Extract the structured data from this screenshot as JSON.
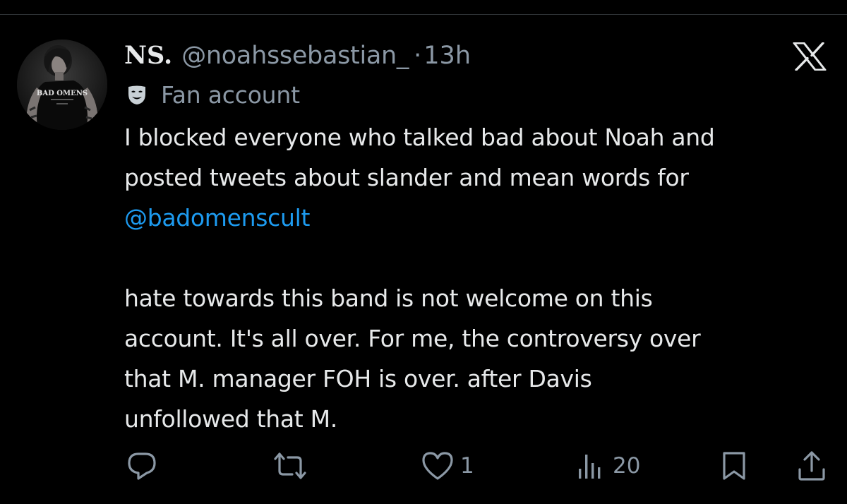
{
  "tweet": {
    "author": {
      "display_name": "NS.",
      "handle": "@noahssebastian_",
      "separator": "·",
      "time": "13h",
      "avatar_shirt_text": "BAD OMENS"
    },
    "label": {
      "icon": "theater-mask-icon",
      "text": "Fan account"
    },
    "text": {
      "line1": "I blocked everyone who talked bad about Noah and",
      "line2": "posted tweets about slander and mean words for",
      "mention": "@badomenscult",
      "line4": "hate towards this band is not welcome on this",
      "line5": "account. It's all over. For me, the controversy over",
      "line6": "that M. manager FOH is over. after Davis",
      "line7": "unfollowed that M."
    },
    "actions": {
      "reply": {
        "icon": "reply-icon"
      },
      "repost": {
        "icon": "repost-icon"
      },
      "like": {
        "icon": "heart-icon",
        "count": "1"
      },
      "views": {
        "icon": "views-icon",
        "count": "20"
      },
      "bookmark": {
        "icon": "bookmark-icon"
      },
      "share": {
        "icon": "share-icon"
      }
    }
  },
  "colors": {
    "background": "#000000",
    "text_primary": "#e7e9ea",
    "text_secondary": "#8b98a5",
    "mention": "#1d9bf0",
    "divider": "#2f3336"
  }
}
